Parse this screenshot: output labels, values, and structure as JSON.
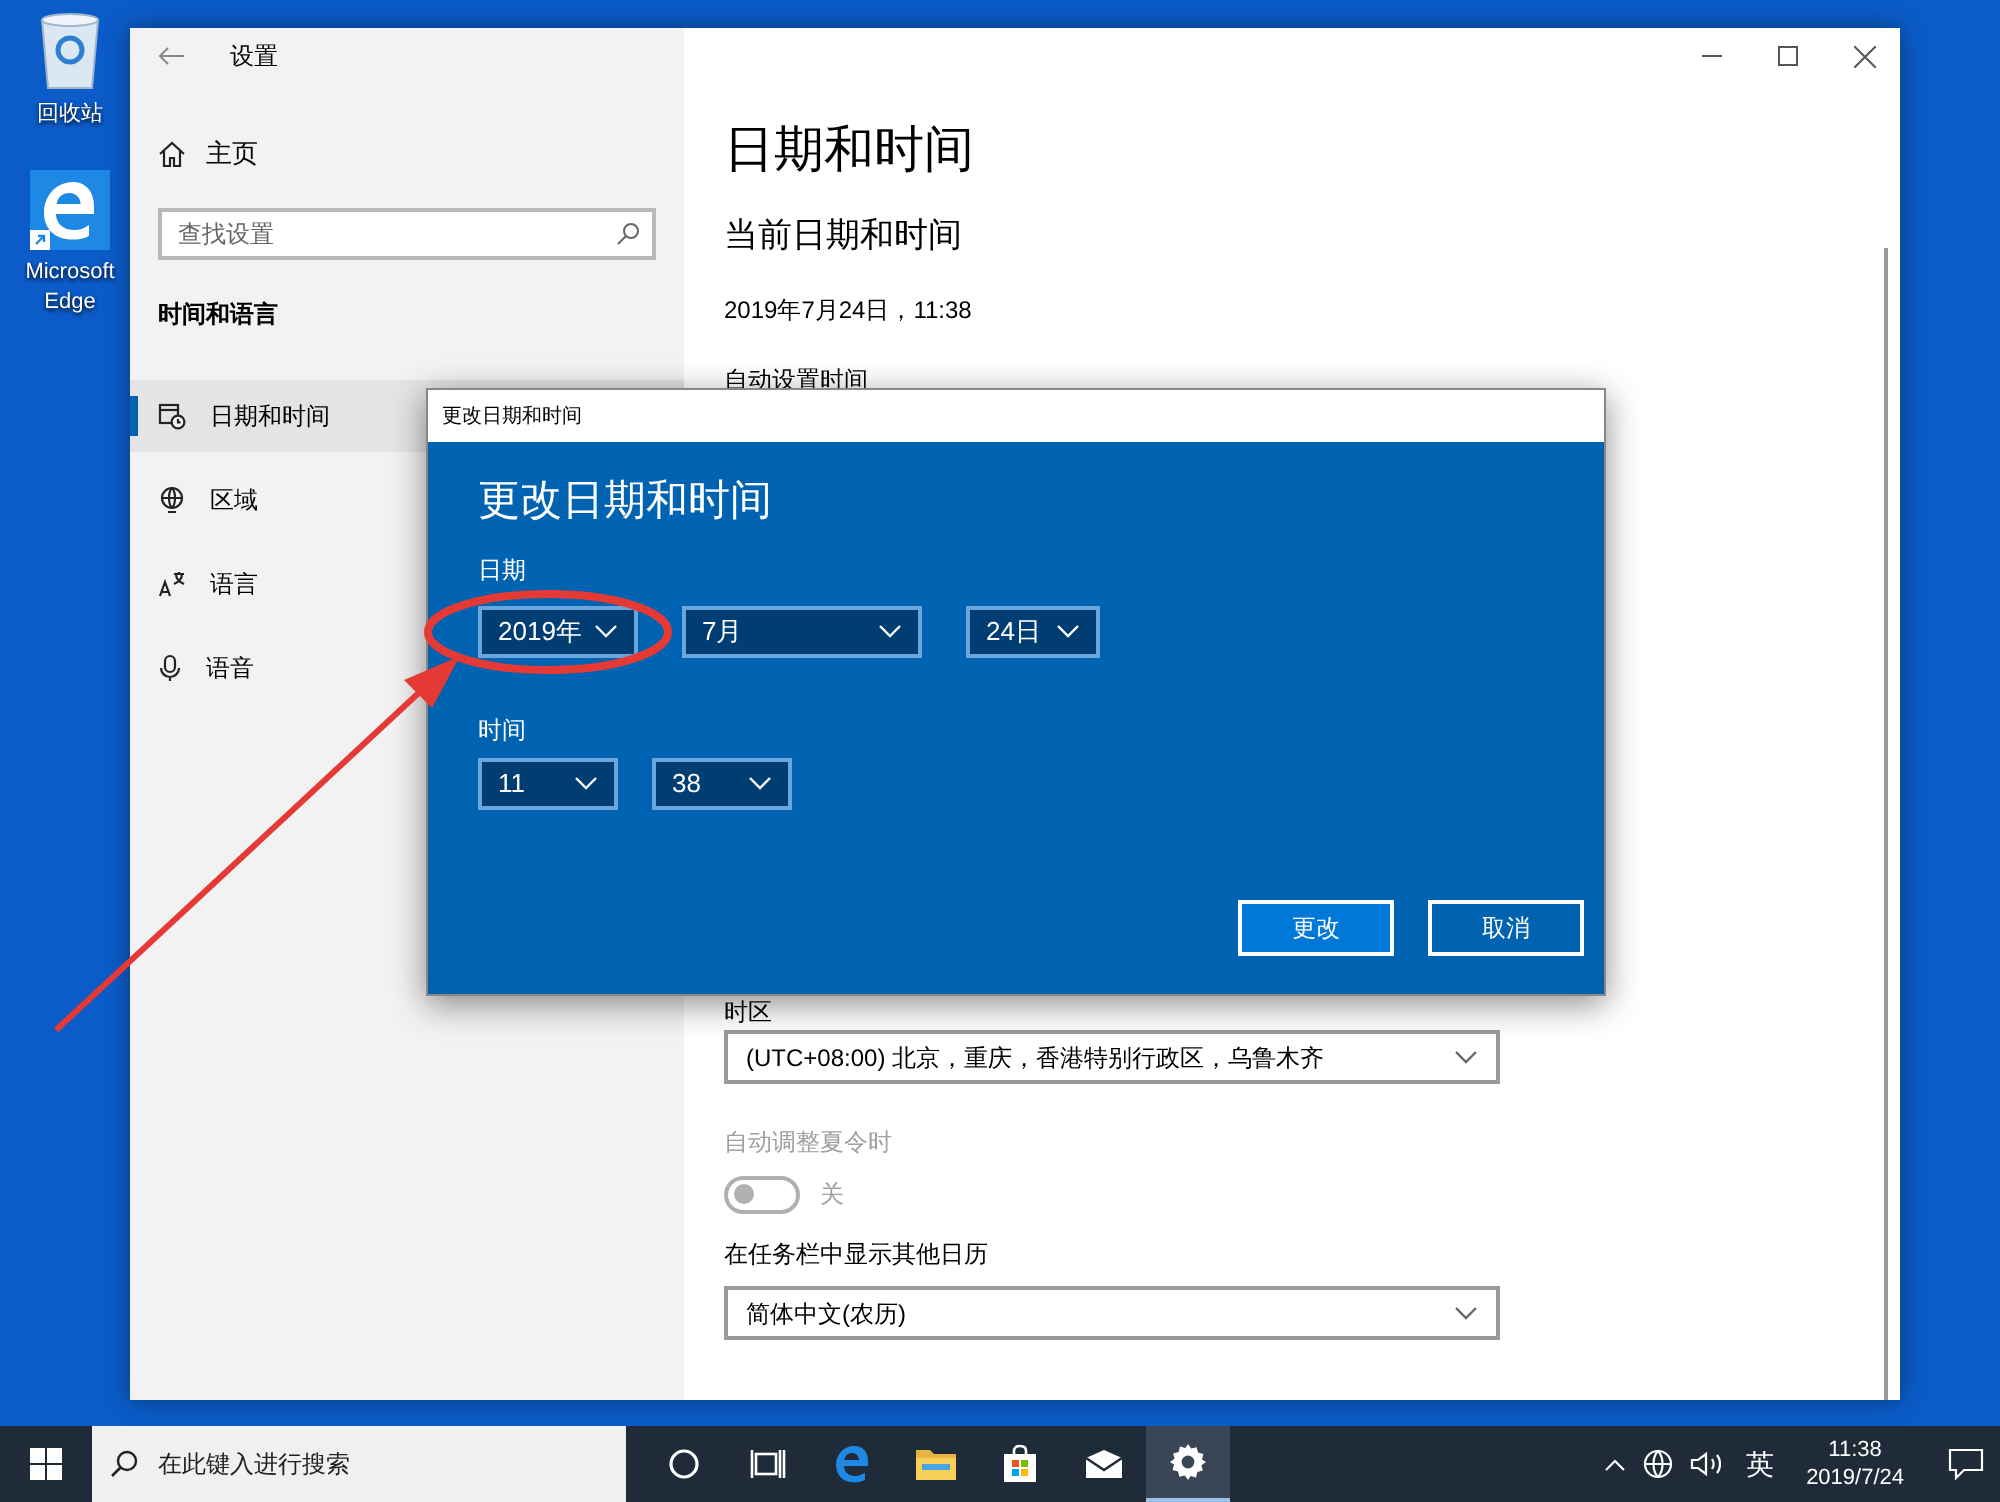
{
  "desktop_icons": [
    {
      "kind": "recycle-bin",
      "label": "回收站"
    },
    {
      "kind": "edge",
      "label": "Microsoft Edge"
    }
  ],
  "settings": {
    "title": "设置",
    "home": "主页",
    "search": {
      "placeholder": "查找设置"
    },
    "section": "时间和语言",
    "nav_items": [
      {
        "kind": "clock",
        "label": "日期和时间",
        "selected": true
      },
      {
        "kind": "globe",
        "label": "区域",
        "selected": false
      },
      {
        "kind": "language",
        "label": "语言",
        "selected": false
      },
      {
        "kind": "mic",
        "label": "语音",
        "selected": false
      }
    ],
    "content": {
      "heading": "日期和时间",
      "subheading": "当前日期和时间",
      "current": "2019年7月24日，11:38",
      "auto_time_label": "自动设置时间",
      "timezone_label": "时区",
      "timezone": "(UTC+08:00) 北京，重庆，香港特别行政区，乌鲁木齐",
      "dst": {
        "label": "自动调整夏令时",
        "on": false,
        "state_text": "关",
        "disabled": true
      },
      "calendar_label": "在任务栏中显示其他日历",
      "calendar": "简体中文(农历)"
    }
  },
  "dialog": {
    "title": "更改日期和时间",
    "heading": "更改日期和时间",
    "date_label": "日期",
    "date_fields": [
      {
        "value": "2019年"
      },
      {
        "value": "7月"
      },
      {
        "value": "24日"
      }
    ],
    "time_label": "时间",
    "time_fields": [
      {
        "value": "11"
      },
      {
        "value": "38"
      }
    ],
    "buttons": [
      {
        "label": "更改",
        "kind": "primary"
      },
      {
        "label": "取消",
        "kind": "secondary"
      }
    ]
  },
  "taskbar": {
    "search": {
      "placeholder": "在此键入进行搜索"
    },
    "apps": [
      {
        "kind": "cortana",
        "selected": false
      },
      {
        "kind": "task-view",
        "selected": false
      },
      {
        "kind": "edge",
        "selected": false
      },
      {
        "kind": "folder",
        "selected": false
      },
      {
        "kind": "store",
        "selected": false
      },
      {
        "kind": "mail",
        "selected": false
      },
      {
        "kind": "settings",
        "selected": true
      }
    ],
    "ime": "英",
    "time": "11:38",
    "date": "2019/7/24"
  }
}
